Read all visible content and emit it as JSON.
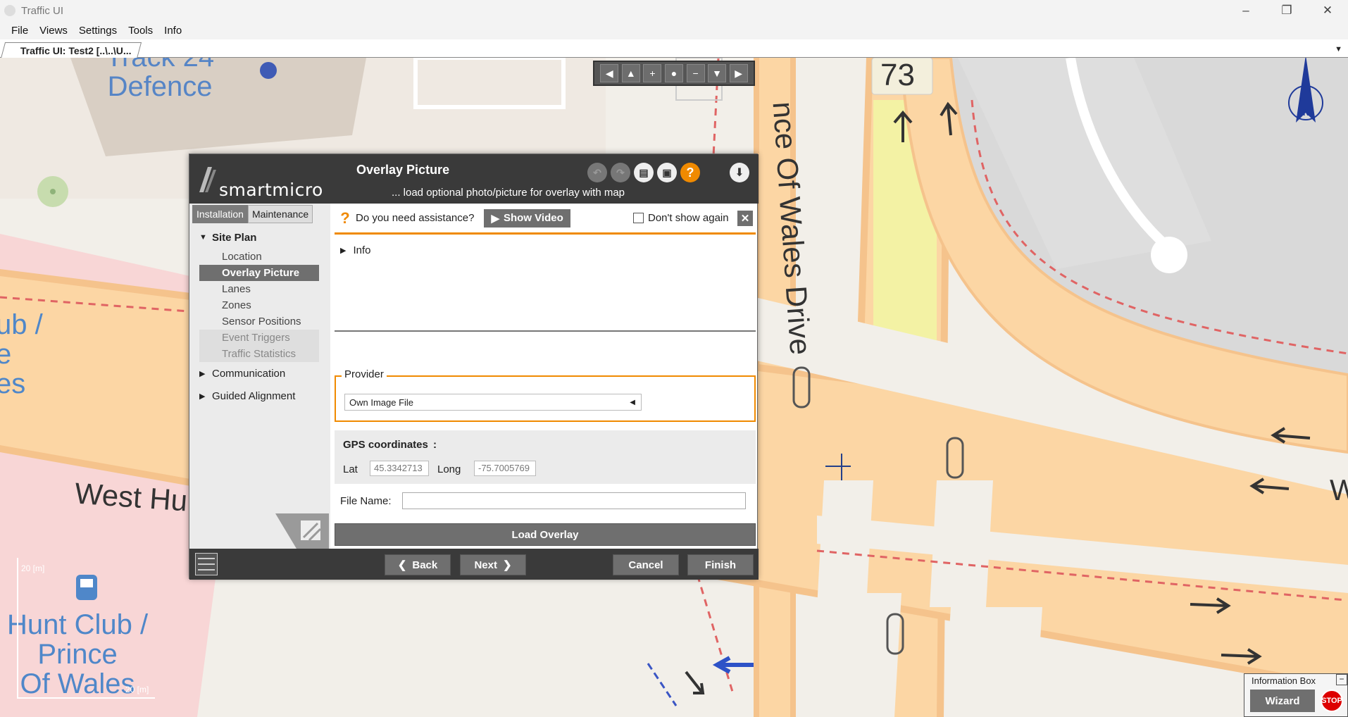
{
  "window": {
    "title": "Traffic UI",
    "controls": [
      "–",
      "❐",
      "✕"
    ]
  },
  "menu": [
    "File",
    "Views",
    "Settings",
    "Tools",
    "Info"
  ],
  "doc_tab": {
    "label": "Traffic UI: Test2 [..\\..\\U..."
  },
  "map": {
    "labels": {
      "defence": "Track 24\nDefence",
      "club_left": "ub /\ne\nes",
      "west_hunt": "West Hu",
      "station": "Hunt Club /\nPrince\nOf Wales",
      "road_num": "73",
      "prince_wales": "nce Of Wales Drive",
      "w_right": "W"
    },
    "scale_top": "20 [m]",
    "scale_right": "20 [m]",
    "compass_letter": "N",
    "nav_buttons": [
      "◀",
      "▲",
      "+",
      "●",
      "−",
      "▼",
      "▶"
    ]
  },
  "dialog": {
    "brand": "smartmicro",
    "title": "Overlay Picture",
    "subtitle": "... load optional photo/picture for overlay with map",
    "header_icons": [
      "undo-icon",
      "redo-icon",
      "save-icon",
      "save-as-icon",
      "help-icon",
      "download-icon"
    ],
    "sidebar": {
      "tabs": [
        "Installation",
        "Maintenance"
      ],
      "site_plan": "Site Plan",
      "items": [
        {
          "label": "Location",
          "state": "normal"
        },
        {
          "label": "Overlay Picture",
          "state": "active"
        },
        {
          "label": "Lanes",
          "state": "normal"
        },
        {
          "label": "Zones",
          "state": "normal"
        },
        {
          "label": "Sensor Positions",
          "state": "normal"
        },
        {
          "label": "Event Triggers",
          "state": "disabled"
        },
        {
          "label": "Traffic Statistics",
          "state": "disabled"
        }
      ],
      "communication": "Communication",
      "guided_alignment": "Guided Alignment"
    },
    "assist": {
      "question": "Do you need assistance?",
      "show_video": "Show Video",
      "dont_show": "Don't show again",
      "close": "✕"
    },
    "info_label": "Info",
    "provider": {
      "legend": "Provider",
      "selected": "Own Image File"
    },
    "gps": {
      "heading": "GPS coordinates",
      "colon": ":",
      "lat_label": "Lat",
      "lat_value": "45.3342713",
      "long_label": "Long",
      "long_value": "-75.7005769"
    },
    "file_name_label": "File Name:",
    "file_name_value": "",
    "load_overlay": "Load Overlay",
    "footer": {
      "back": "Back",
      "next": "Next",
      "cancel": "Cancel",
      "finish": "Finish"
    }
  },
  "info_box": {
    "title": "Information Box",
    "minimize": "−",
    "wizard": "Wizard",
    "stop": "STOP"
  },
  "colors": {
    "accent": "#f08a00",
    "dark": "#3a3a3a",
    "button": "#6f6f6f",
    "road": "#fcd6a4",
    "map_bg": "#f2efe9"
  }
}
